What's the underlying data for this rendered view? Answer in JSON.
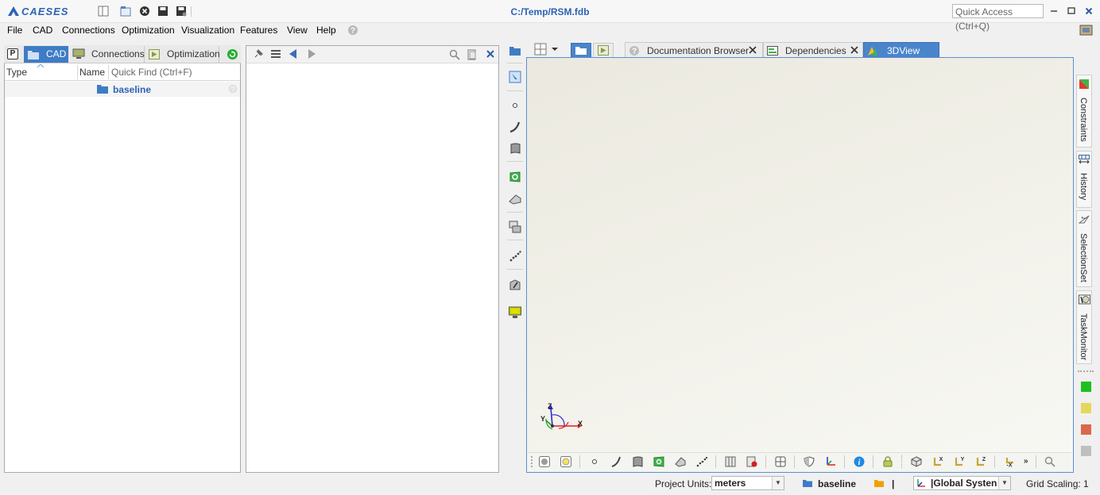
{
  "app": {
    "logo_text": "CAESES",
    "title": "C:/Temp/RSM.fdb",
    "quick_access_placeholder": "Quick Access (Ctrl+Q)",
    "window_controls": [
      "minimize-icon",
      "maximize-icon",
      "close-icon"
    ],
    "toolbar_icons": [
      "layout-icon",
      "open-folder-icon",
      "close-project-icon",
      "save-icon",
      "save-as-icon"
    ]
  },
  "menu": [
    "File",
    "CAD",
    "Connections",
    "Optimization",
    "Visualization",
    "Features",
    "View",
    "Help"
  ],
  "left_panel": {
    "tabs": [
      "CAD",
      "Connections",
      "Optimization"
    ],
    "active_tab": "CAD",
    "columns": {
      "type": "Type",
      "name": "Name",
      "quick_find": "Quick Find (Ctrl+F)"
    },
    "tree": [
      {
        "label": "baseline",
        "icon": "folder-icon"
      }
    ]
  },
  "right_area": {
    "doc_tabs": [
      "Documentation Browser",
      "Dependencies",
      "3DView"
    ],
    "active_doc_tab": "3DView",
    "side_tabs": [
      "Constraints",
      "History",
      "SelectionSet",
      "TaskMonitor"
    ],
    "status_colors": [
      "#1fbf1f",
      "#e3d85a",
      "#d96a4c",
      "#bfbfbf"
    ],
    "axes": {
      "x": "X",
      "y": "Y",
      "z": "Z"
    }
  },
  "status_bar": {
    "units_label": "Project Units:",
    "units_value": "meters",
    "design": "baseline",
    "separator": "|",
    "coord_system": "|Global Systen",
    "grid_scaling": "Grid Scaling: 1"
  },
  "colors": {
    "accent": "#2c63b5",
    "tab_active": "#3f7cc6",
    "viewport_border": "#5b8fd1"
  }
}
